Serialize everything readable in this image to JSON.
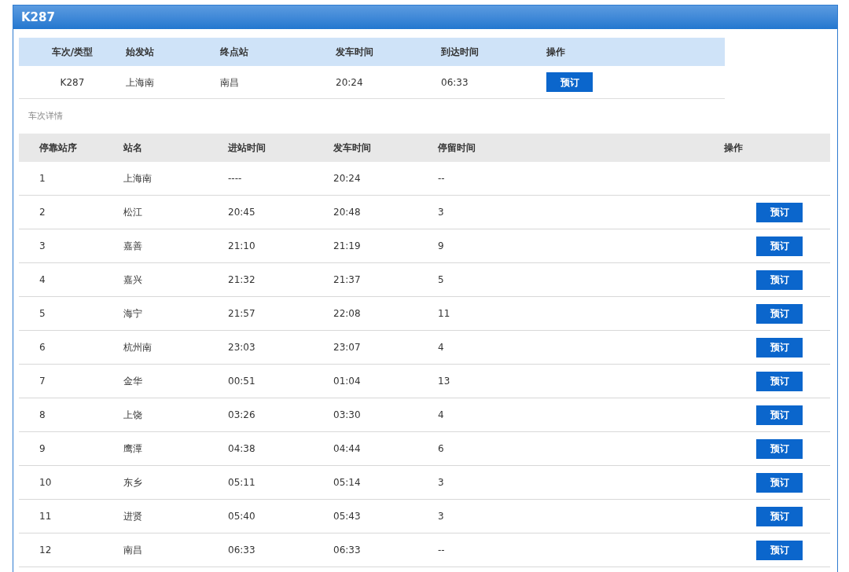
{
  "panel": {
    "title": "K287"
  },
  "summary": {
    "columns": [
      "车次/类型",
      "始发站",
      "终点站",
      "发车时间",
      "到达时间",
      "操作"
    ],
    "row": {
      "train": "K287",
      "from": "上海南",
      "to": "南昌",
      "depart": "20:24",
      "arrive": "06:33",
      "action": "预订"
    }
  },
  "details": {
    "label": "车次详情",
    "columns": [
      "停靠站序",
      "站名",
      "进站时间",
      "发车时间",
      "停留时间",
      "操作"
    ],
    "rows": [
      {
        "seq": "1",
        "station": "上海南",
        "arrive": "----",
        "depart": "20:24",
        "stop": "--"
      },
      {
        "seq": "2",
        "station": "松江",
        "arrive": "20:45",
        "depart": "20:48",
        "stop": "3",
        "action": "预订"
      },
      {
        "seq": "3",
        "station": "嘉善",
        "arrive": "21:10",
        "depart": "21:19",
        "stop": "9",
        "action": "预订"
      },
      {
        "seq": "4",
        "station": "嘉兴",
        "arrive": "21:32",
        "depart": "21:37",
        "stop": "5",
        "action": "预订"
      },
      {
        "seq": "5",
        "station": "海宁",
        "arrive": "21:57",
        "depart": "22:08",
        "stop": "11",
        "action": "预订"
      },
      {
        "seq": "6",
        "station": "杭州南",
        "arrive": "23:03",
        "depart": "23:07",
        "stop": "4",
        "action": "预订"
      },
      {
        "seq": "7",
        "station": "金华",
        "arrive": "00:51",
        "depart": "01:04",
        "stop": "13",
        "action": "预订"
      },
      {
        "seq": "8",
        "station": "上饶",
        "arrive": "03:26",
        "depart": "03:30",
        "stop": "4",
        "action": "预订"
      },
      {
        "seq": "9",
        "station": "鹰潭",
        "arrive": "04:38",
        "depart": "04:44",
        "stop": "6",
        "action": "预订"
      },
      {
        "seq": "10",
        "station": "东乡",
        "arrive": "05:11",
        "depart": "05:14",
        "stop": "3",
        "action": "预订"
      },
      {
        "seq": "11",
        "station": "进贤",
        "arrive": "05:40",
        "depart": "05:43",
        "stop": "3",
        "action": "预订"
      },
      {
        "seq": "12",
        "station": "南昌",
        "arrive": "06:33",
        "depart": "06:33",
        "stop": "--",
        "action": "预订"
      }
    ]
  }
}
